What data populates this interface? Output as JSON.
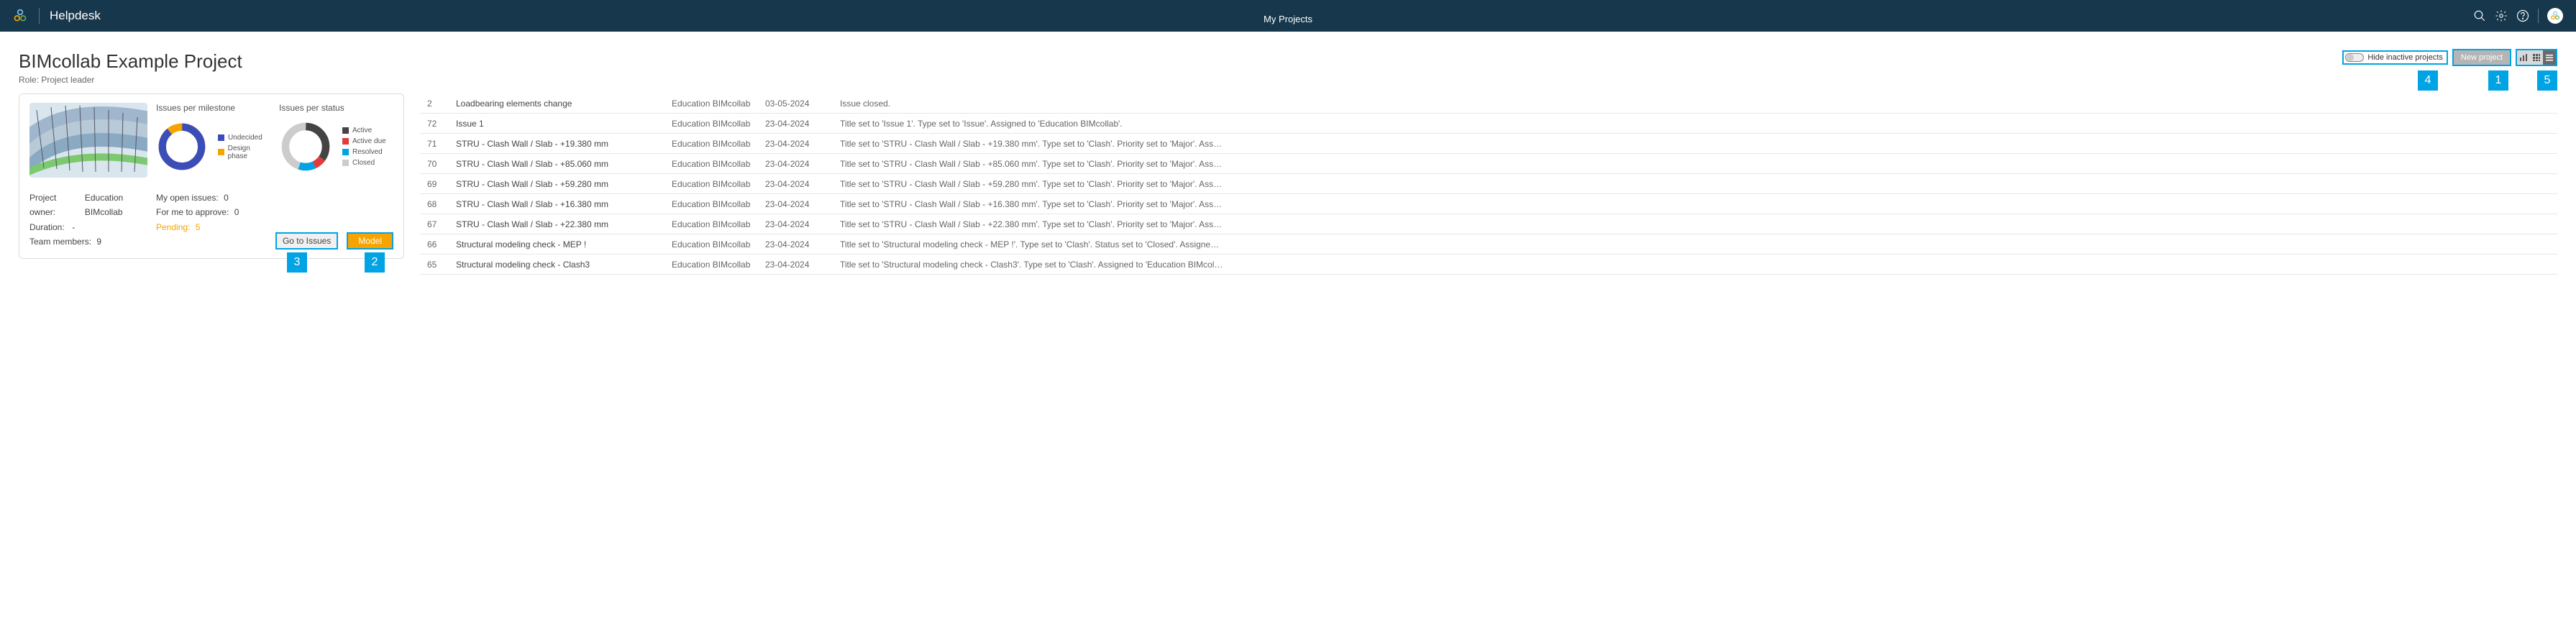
{
  "header": {
    "brand": "Helpdesk",
    "nav_active": "My Projects"
  },
  "toolbar": {
    "hide_inactive_label": "Hide inactive projects",
    "new_project_label": "New project"
  },
  "callouts": {
    "c1": "1",
    "c2": "2",
    "c3": "3",
    "c4": "4",
    "c5": "5"
  },
  "project": {
    "title": "BIMcollab Example Project",
    "role_label": "Role:",
    "role_value": "Project leader",
    "chart1_title": "Issues per milestone",
    "chart2_title": "Issues per status",
    "owner_label": "Project owner:",
    "owner_value": "Education BIMcollab",
    "duration_label": "Duration:",
    "duration_value": "-",
    "members_label": "Team members:",
    "members_value": "9",
    "open_label": "My open issues:",
    "open_value": "0",
    "approve_label": "For me to approve:",
    "approve_value": "0",
    "pending_label": "Pending:",
    "pending_value": "5",
    "btn_issues": "Go to Issues",
    "btn_model": "Model"
  },
  "legend_milestone": [
    {
      "color": "#3b4db8",
      "label": "Undecided"
    },
    {
      "color": "#f7a400",
      "label": "Design phase"
    }
  ],
  "legend_status": [
    {
      "color": "#444444",
      "label": "Active"
    },
    {
      "color": "#e23b3b",
      "label": "Active due"
    },
    {
      "color": "#00a4e4",
      "label": "Resolved"
    },
    {
      "color": "#cccccc",
      "label": "Closed"
    }
  ],
  "chart_data": [
    {
      "type": "pie",
      "title": "Issues per milestone",
      "series": [
        {
          "name": "Undecided",
          "value": 89,
          "color": "#3b4db8"
        },
        {
          "name": "Design phase",
          "value": 11,
          "color": "#f7a400"
        }
      ]
    },
    {
      "type": "pie",
      "title": "Issues per status",
      "series": [
        {
          "name": "Active",
          "value": 35,
          "color": "#444444"
        },
        {
          "name": "Active due",
          "value": 8,
          "color": "#e23b3b"
        },
        {
          "name": "Resolved",
          "value": 12,
          "color": "#00a4e4"
        },
        {
          "name": "Closed",
          "value": 45,
          "color": "#cccccc"
        }
      ]
    }
  ],
  "issues": [
    {
      "id": "2",
      "title": "Loadbearing elements change",
      "edu": "Education BIMcollab",
      "date": "03-05-2024",
      "desc": "Issue closed."
    },
    {
      "id": "72",
      "title": "Issue 1",
      "edu": "Education BIMcollab",
      "date": "23-04-2024",
      "desc": "Title set to 'Issue 1'. Type set to 'Issue'. Assigned to 'Education BIMcollab'."
    },
    {
      "id": "71",
      "title": "STRU - Clash Wall / Slab - +19.380 mm",
      "edu": "Education BIMcollab",
      "date": "23-04-2024",
      "desc": "Title set to 'STRU - Clash Wall / Slab - +19.380 mm'. Type set to 'Clash'. Priority set to 'Major'. Ass…"
    },
    {
      "id": "70",
      "title": "STRU - Clash Wall / Slab - +85.060 mm",
      "edu": "Education BIMcollab",
      "date": "23-04-2024",
      "desc": "Title set to 'STRU - Clash Wall / Slab - +85.060 mm'. Type set to 'Clash'. Priority set to 'Major'. Ass…"
    },
    {
      "id": "69",
      "title": "STRU - Clash Wall / Slab - +59.280 mm",
      "edu": "Education BIMcollab",
      "date": "23-04-2024",
      "desc": "Title set to 'STRU - Clash Wall / Slab - +59.280 mm'. Type set to 'Clash'. Priority set to 'Major'. Ass…"
    },
    {
      "id": "68",
      "title": "STRU - Clash Wall / Slab - +16.380 mm",
      "edu": "Education BIMcollab",
      "date": "23-04-2024",
      "desc": "Title set to 'STRU - Clash Wall / Slab - +16.380 mm'. Type set to 'Clash'. Priority set to 'Major'. Ass…"
    },
    {
      "id": "67",
      "title": "STRU - Clash Wall / Slab - +22.380 mm",
      "edu": "Education BIMcollab",
      "date": "23-04-2024",
      "desc": "Title set to 'STRU - Clash Wall / Slab - +22.380 mm'. Type set to 'Clash'. Priority set to 'Major'. Ass…"
    },
    {
      "id": "66",
      "title": "Structural modeling check - MEP !",
      "edu": "Education BIMcollab",
      "date": "23-04-2024",
      "desc": "Title set to 'Structural modeling check - MEP !'. Type set to 'Clash'. Status set to 'Closed'. Assigne…"
    },
    {
      "id": "65",
      "title": "Structural modeling check - Clash3",
      "edu": "Education BIMcollab",
      "date": "23-04-2024",
      "desc": "Title set to 'Structural modeling check - Clash3'. Type set to 'Clash'. Assigned to 'Education BIMcol…"
    }
  ]
}
